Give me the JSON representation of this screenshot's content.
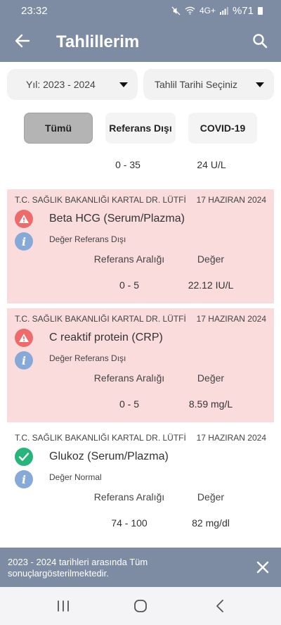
{
  "status_bar": {
    "time": "23:32",
    "network": "4G+",
    "battery": "%71"
  },
  "header": {
    "title": "Tahlillerim",
    "back_icon": "arrow-left-icon",
    "search_icon": "search-icon"
  },
  "filters": {
    "year": "Yıl: 2023 - 2024",
    "date_placeholder": "Tahlil Tarihi Seçiniz"
  },
  "tabs": [
    {
      "label": "Tümü",
      "selected": true
    },
    {
      "label": "Referans Dışı",
      "selected": false
    },
    {
      "label": "COVID-19",
      "selected": false
    }
  ],
  "partial_row": {
    "range": "0 - 35",
    "value": "24 U/L"
  },
  "results": [
    {
      "institution": "T.C. SAĞLIK BAKANLIĞI KARTAL DR. LÜTFİ",
      "date": "17 HAZIRAN 2024",
      "test": "Beta HCG (Serum/Plazma)",
      "status": "Değer Referans Dışı",
      "status_kind": "warning",
      "range_label": "Referans Aralığı",
      "value_label": "Değer",
      "range": "0 - 5",
      "value": "22.12 IU/L"
    },
    {
      "institution": "T.C. SAĞLIK BAKANLIĞI KARTAL DR. LÜTFİ",
      "date": "17 HAZIRAN 2024",
      "test": "C reaktif protein (CRP)",
      "status": "Değer Referans Dışı",
      "status_kind": "warning",
      "range_label": "Referans Aralığı",
      "value_label": "Değer",
      "range": "0 - 5",
      "value": "8.59 mg/L"
    },
    {
      "institution": "T.C. SAĞLIK BAKANLIĞI KARTAL DR. LÜTFİ",
      "date": "17 HAZIRAN 2024",
      "test": "Glukoz (Serum/Plazma)",
      "status": "Değer Normal",
      "status_kind": "normal",
      "range_label": "Referans Aralığı",
      "value_label": "Değer",
      "range": "74 - 100",
      "value": "82 mg/dl"
    }
  ],
  "snackbar": {
    "message": "2023 - 2024 tarihleri arasında Tüm sonuçlargösterilmektedir."
  },
  "colors": {
    "header": "#7d8ba3",
    "out_of_range_bg": "#fadcdc",
    "warning": "#ef6b6b",
    "normal": "#26b57a",
    "info": "#86a9d8"
  }
}
